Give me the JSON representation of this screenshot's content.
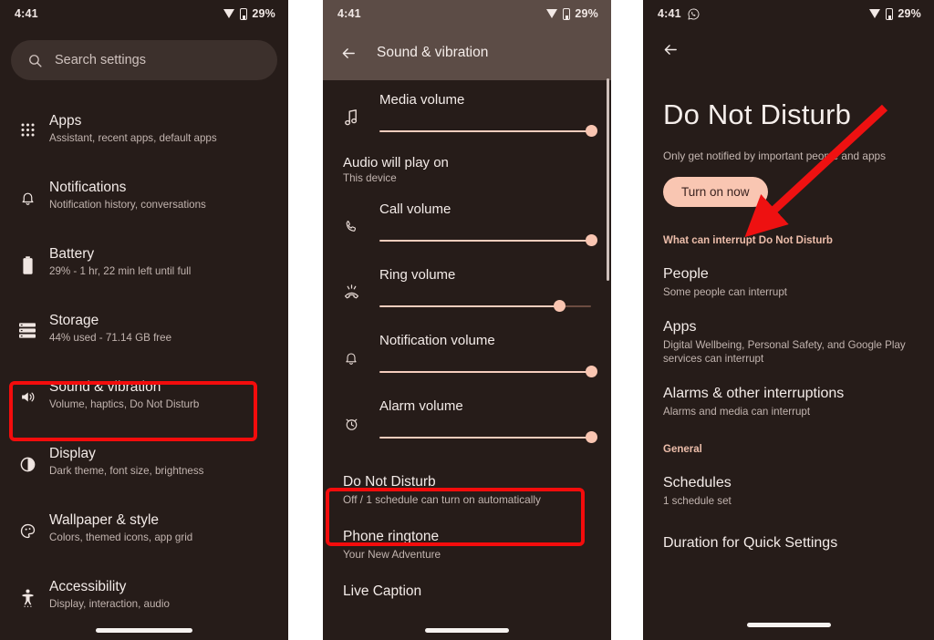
{
  "colors": {
    "bg_dark": "#261c19",
    "header_light": "#5c4c46",
    "accent_peach": "#f9c6b2",
    "accent_text": "#ecbdaa",
    "highlight_red": "#f30c0c",
    "arrow_red": "#ee1111"
  },
  "panel1": {
    "statusbar": {
      "time": "4:41",
      "battery": "29%",
      "wifi_icon": "wifi-icon",
      "battery_icon": "battery-icon"
    },
    "search": {
      "placeholder": "Search settings",
      "icon": "search-icon"
    },
    "items": [
      {
        "icon": "apps-grid-icon",
        "title": "Apps",
        "sub": "Assistant, recent apps, default apps"
      },
      {
        "icon": "bell-icon",
        "title": "Notifications",
        "sub": "Notification history, conversations"
      },
      {
        "icon": "battery-icon",
        "title": "Battery",
        "sub": "29% - 1 hr, 22 min left until full"
      },
      {
        "icon": "storage-icon",
        "title": "Storage",
        "sub": "44% used - 71.14 GB free"
      },
      {
        "icon": "volume-icon",
        "title": "Sound & vibration",
        "sub": "Volume, haptics, Do Not Disturb"
      },
      {
        "icon": "brightness-icon",
        "title": "Display",
        "sub": "Dark theme, font size, brightness"
      },
      {
        "icon": "palette-icon",
        "title": "Wallpaper & style",
        "sub": "Colors, themed icons, app grid"
      },
      {
        "icon": "accessibility-icon",
        "title": "Accessibility",
        "sub": "Display, interaction, audio"
      }
    ],
    "highlight_index": 4
  },
  "panel2": {
    "statusbar": {
      "time": "4:41",
      "battery": "29%",
      "wifi_icon": "wifi-icon",
      "battery_icon": "battery-icon"
    },
    "header": {
      "title": "Sound & vibration",
      "back_icon": "back-arrow-icon"
    },
    "sliders": [
      {
        "icon": "music-note-icon",
        "label": "Media volume",
        "value": 100
      },
      {
        "icon": "phone-icon",
        "label": "Call volume",
        "value": 100
      },
      {
        "icon": "ring-volume-icon",
        "label": "Ring volume",
        "value": 85
      },
      {
        "icon": "bell-icon",
        "label": "Notification volume",
        "value": 100
      },
      {
        "icon": "alarm-clock-icon",
        "label": "Alarm volume",
        "value": 100
      }
    ],
    "audio_output": {
      "title": "Audio will play on",
      "sub": "This device"
    },
    "rows": [
      {
        "title": "Do Not Disturb",
        "sub": "Off / 1 schedule can turn on automatically"
      },
      {
        "title": "Phone ringtone",
        "sub": "Your New Adventure"
      },
      {
        "title": "Live Caption",
        "sub": ""
      }
    ],
    "highlight_row_index": 0
  },
  "panel3": {
    "statusbar": {
      "time": "4:41",
      "battery": "29%",
      "app_icon": "whatsapp-icon",
      "wifi_icon": "wifi-icon",
      "battery_icon": "battery-icon"
    },
    "back_icon": "back-arrow-icon",
    "title": "Do Not Disturb",
    "description": "Only get notified by important people and apps",
    "turn_on_label": "Turn on now",
    "section_interrupt": "What can interrupt Do Not Disturb",
    "section_general": "General",
    "interrupt_rows": [
      {
        "title": "People",
        "sub": "Some people can interrupt"
      },
      {
        "title": "Apps",
        "sub": "Digital Wellbeing, Personal Safety, and Google Play services can interrupt"
      },
      {
        "title": "Alarms & other interruptions",
        "sub": "Alarms and media can interrupt"
      }
    ],
    "general_rows": [
      {
        "title": "Schedules",
        "sub": "1 schedule set"
      },
      {
        "title": "Duration for Quick Settings",
        "sub": ""
      }
    ],
    "annotation": {
      "type": "arrow",
      "points_to": "turn-on-now-button",
      "color": "#ee1111"
    }
  }
}
